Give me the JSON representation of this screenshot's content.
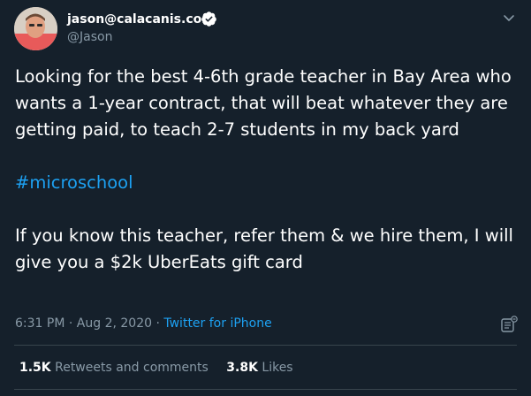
{
  "author": {
    "name": "jason@calacanis.com",
    "handle": "@Jason"
  },
  "tweet": {
    "line1": "Looking for the best 4-6th grade teacher in Bay Area who wants a 1-year contract, that will beat whatever they are getting paid, to teach 2-7 students in my back yard",
    "hashtag": "#microschool",
    "line3": "If you know this teacher, refer them & we hire them, I will give you a $2k UberEats gift card"
  },
  "meta": {
    "time": "6:31 PM",
    "separator1": " · ",
    "date": "Aug 2, 2020",
    "separator2": " · ",
    "source": "Twitter for iPhone"
  },
  "stats": {
    "retweets_count": "1.5K",
    "retweets_label": "Retweets and comments",
    "likes_count": "3.8K",
    "likes_label": "Likes"
  },
  "colors": {
    "background": "#15202b",
    "link": "#1da1f2",
    "secondary_text": "#8899a6",
    "divider": "#38444d"
  },
  "icons": {
    "verified": "verified-badge-icon",
    "more": "chevron-down-icon",
    "moderation": "moderation-icon"
  }
}
